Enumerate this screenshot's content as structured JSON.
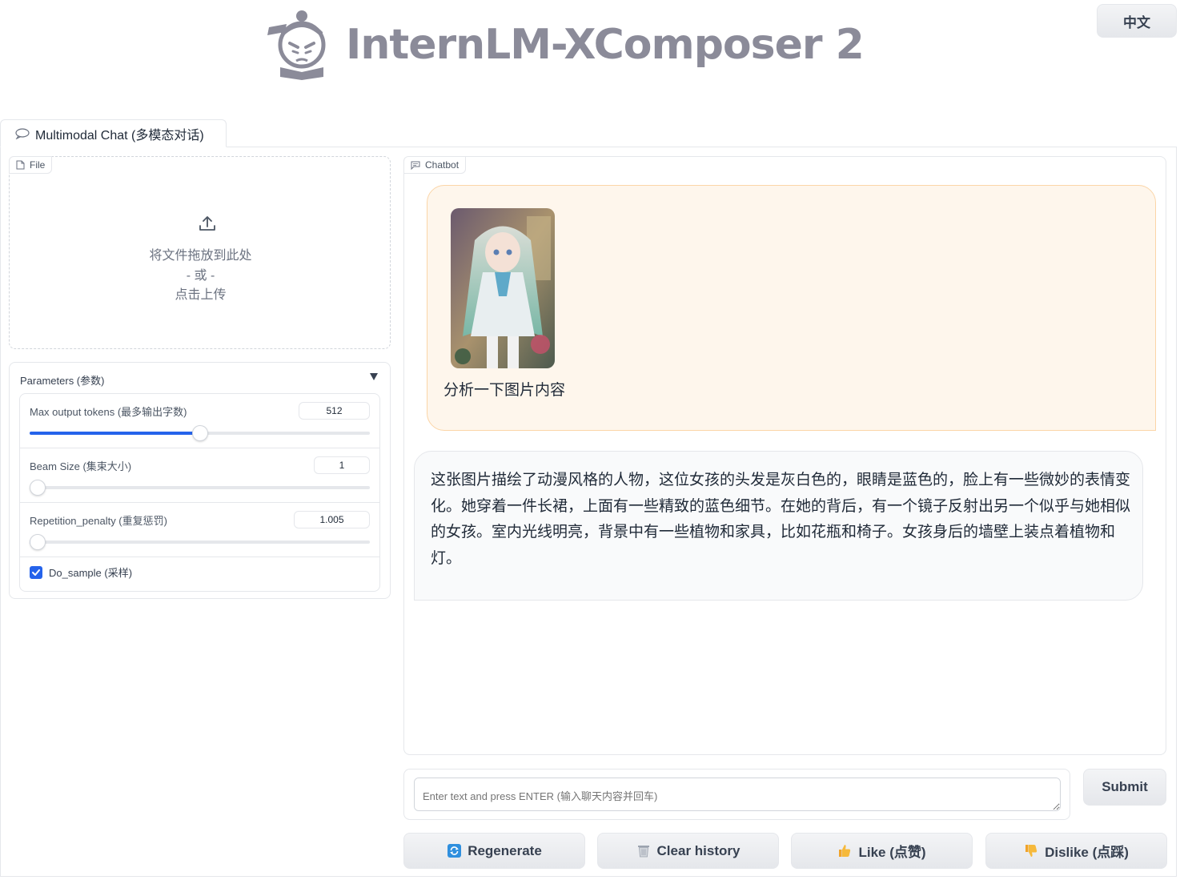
{
  "header": {
    "brand": "InternLM-XComposer 2",
    "lang_button": "中文"
  },
  "tabs": [
    {
      "label": "Multimodal Chat (多模态对话)",
      "icon": "chat-bubble-icon",
      "selected": true
    }
  ],
  "file_upload": {
    "label": "File",
    "drop_text": "将文件拖放到此处",
    "or_text": "- 或 -",
    "click_text": "点击上传"
  },
  "parameters": {
    "title": "Parameters (参数)",
    "max_tokens": {
      "label": "Max output tokens (最多输出字数)",
      "value": "512",
      "fraction": 0.5
    },
    "beam_size": {
      "label": "Beam Size (集束大小)",
      "value": "1",
      "fraction": 0.0
    },
    "repetition_penalty": {
      "label": "Repetition_penalty (重复惩罚)",
      "value": "1.005",
      "fraction": 0.005
    },
    "do_sample": {
      "label": "Do_sample (采样)",
      "checked": true
    }
  },
  "chatbot": {
    "label": "Chatbot",
    "user_message": "分析一下图片内容",
    "bot_message": "这张图片描绘了动漫风格的人物，这位女孩的头发是灰白色的，眼睛是蓝色的，脸上有一些微妙的表情变化。她穿着一件长裙，上面有一些精致的蓝色细节。在她的背后，有一个镜子反射出另一个似乎与她相似的女孩。室内光线明亮，背景中有一些植物和家具，比如花瓶和椅子。女孩身后的墙壁上装点着植物和灯。"
  },
  "input": {
    "placeholder": "Enter text and press ENTER (输入聊天内容并回车)",
    "submit_label": "Submit"
  },
  "actions": {
    "regenerate": "Regenerate",
    "clear_history": "Clear history",
    "like": "Like (点赞)",
    "dislike": "Dislike (点踩)"
  }
}
